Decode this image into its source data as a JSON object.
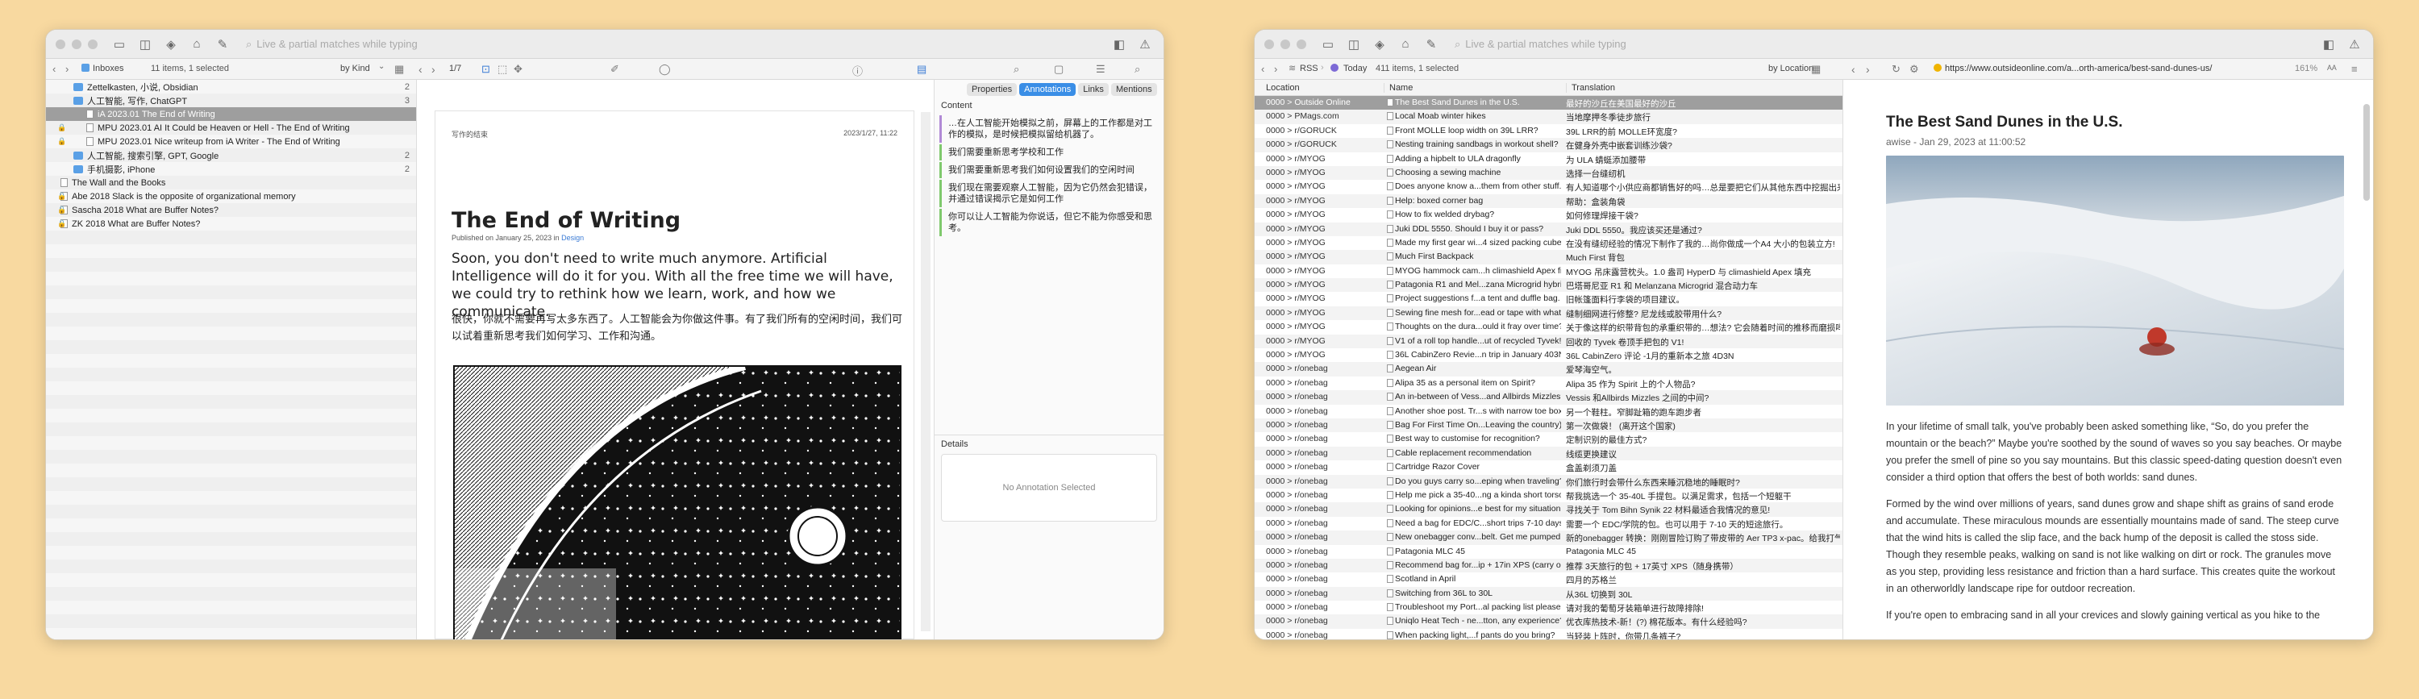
{
  "w1": {
    "search": "Live & partial matches while typing",
    "crumb": "Inboxes",
    "count": "11 items, 1 selected",
    "sort": "by Kind",
    "pager": "1/7",
    "sidebar": [
      {
        "label": "Zettelkasten, 小说, Obsidian",
        "kind": "folder",
        "indent": 1,
        "count": "2"
      },
      {
        "label": "人工智能, 写作, ChatGPT",
        "kind": "folder",
        "indent": 1,
        "count": "3"
      },
      {
        "label": "iA 2023.01 The End of Writing",
        "kind": "doc",
        "indent": 2,
        "count": "",
        "selected": true
      },
      {
        "label": "MPU 2023.01 AI It Could be Heaven or Hell - The End of Writing",
        "kind": "doc",
        "indent": 2,
        "count": "",
        "lock": true
      },
      {
        "label": "MPU 2023.01 Nice writeup from iA Writer - The End of Writing",
        "kind": "doc",
        "indent": 2,
        "count": "",
        "lock": true
      },
      {
        "label": "人工智能, 搜索引擎, GPT, Google",
        "kind": "folder",
        "indent": 1,
        "count": "2"
      },
      {
        "label": "手机摄影, iPhone",
        "kind": "folder",
        "indent": 1,
        "count": "2"
      },
      {
        "label": "The Wall and the Books",
        "kind": "doc",
        "indent": 0,
        "count": ""
      },
      {
        "label": "Abe 2018 Slack is the opposite of organizational memory",
        "kind": "doc",
        "indent": 0,
        "count": "",
        "lock": true
      },
      {
        "label": "Sascha 2018 What are Buffer Notes?",
        "kind": "doc",
        "indent": 0,
        "count": "",
        "lock": true
      },
      {
        "label": "ZK 2018 What are Buffer Notes?",
        "kind": "doc",
        "indent": 0,
        "count": "",
        "lock": true
      }
    ],
    "doc": {
      "meta_left": "写作的结束",
      "meta_right": "2023/1/27, 11:22",
      "title": "The End of Writing",
      "byline": "Published on January 25, 2023 in",
      "byline_link": "Design",
      "lead": "Soon, you don't need to write much anymore. Artificial Intelligence will do it for you. With all the free time we will have, we could try to rethink how we learn, work, and how we communicate.",
      "cn": "很快，你就不需要再写太多东西了。人工智能会为你做这件事。有了我们所有的空闲时间，我们可以试着重新思考我们如何学习、工作和沟通。"
    },
    "tabs": [
      "Properties",
      "Annotations",
      "Links",
      "Mentions"
    ],
    "content_label": "Content",
    "highlights": [
      {
        "text": "…在人工智能开始模拟之前，屏幕上的工作都是对工作的模拟，是时候把模拟留给机器了。",
        "color": "#b18ad6"
      },
      {
        "text": "我们需要重新思考学校和工作",
        "color": "#7fc96d"
      },
      {
        "text": "我们需要重新思考我们如何设置我们的空闲时间",
        "color": "#7fc96d"
      },
      {
        "text": "我们现在需要观察人工智能，因为它仍然会犯错误，并通过错误揭示它是如何工作",
        "color": "#7fc96d"
      },
      {
        "text": "你可以让人工智能为你说话，但它不能为你感受和思考。",
        "color": "#7fc96d"
      }
    ],
    "details_label": "Details",
    "no_annotation": "No Annotation Selected"
  },
  "w2": {
    "search": "Live & partial matches while typing",
    "crumb_rss": "RSS",
    "crumb_today": "Today",
    "count": "411 items, 1 selected",
    "sort": "by Location",
    "cols": [
      "Location",
      "Name",
      "Translation"
    ],
    "url": "https://www.outsideonline.com/a...orth-america/best-sand-dunes-us/",
    "zoom": "161%",
    "rows": [
      [
        "0000 > Outside Online",
        "The Best Sand Dunes in the U.S.",
        "最好的沙丘在美国最好的沙丘"
      ],
      [
        "0000 > PMags.com",
        "Local Moab winter hikes",
        "当地摩押冬季徒步旅行"
      ],
      [
        "0000 > r/GORUCK",
        "Front MOLLE loop width on 39L LRR?",
        "39L LRR的前 MOLLE环宽度?"
      ],
      [
        "0000 > r/GORUCK",
        "Nesting training sandbags in workout shell?",
        "在健身外壳中嵌套训练沙袋?"
      ],
      [
        "0000 > r/MYOG",
        "Adding a hipbelt to ULA dragonfly",
        "为 ULA 蜻蜓添加腰带"
      ],
      [
        "0000 > r/MYOG",
        "Choosing a sewing machine",
        "选择一台缝纫机"
      ],
      [
        "0000 > r/MYOG",
        "Does anyone know a...them from other stuff.",
        "有人知道哪个小供应商都销售好的吗…总是要把它们从其他东西中挖掘出来。"
      ],
      [
        "0000 > r/MYOG",
        "Help: boxed corner bag",
        "帮助：盒装角袋"
      ],
      [
        "0000 > r/MYOG",
        "How to fix welded drybag?",
        "如何修理焊接干袋?"
      ],
      [
        "0000 > r/MYOG",
        "Juki DDL 5550. Should I buy it or pass?",
        "Juki DDL 5550。我应该买还是通过?"
      ],
      [
        "0000 > r/MYOG",
        "Made my first gear wi...4 sized packing cube!",
        "在没有缝纫经验的情况下制作了我的…尚你做成一个A4 大小的包装立方!"
      ],
      [
        "0000 > r/MYOG",
        "Much First Backpack",
        "Much First 背包"
      ],
      [
        "0000 > r/MYOG",
        "MYOG hammock cam...h climashield Apex fill",
        "MYOG 吊床露营枕头。1.0 盎司 HyperD 与 climashield Apex 填充"
      ],
      [
        "0000 > r/MYOG",
        "Patagonia R1 and Mel...zana Microgrid hybrid",
        "巴塔哥尼亚 R1 和 Melanzana Microgrid 混合动力车"
      ],
      [
        "0000 > r/MYOG",
        "Project suggestions f...a tent and duffle bag.",
        "旧帐篷面料行李袋的项目建议。"
      ],
      [
        "0000 > r/MYOG",
        "Sewing fine mesh for...ead or tape with what?",
        "缝制细网进行修整? 尼龙线或胶带用什么?"
      ],
      [
        "0000 > r/MYOG",
        "Thoughts on the dura...ould it fray over time?",
        "关于像这样的织带背包的承重织带的…想法? 它会随着时间的推移而磨损吗?"
      ],
      [
        "0000 > r/MYOG",
        "V1 of a roll top handle...ut of recycled Tyvek!",
        "回收的 Tyvek 卷顶手把包的 V1!"
      ],
      [
        "0000 > r/MYOG",
        "36L CabinZero Revie...n trip in January 403N",
        "36L CabinZero 评论 -1月的重新本之旅 4D3N"
      ],
      [
        "0000 > r/onebag",
        "Aegean Air",
        "爱琴海空气。"
      ],
      [
        "0000 > r/onebag",
        "Alipa 35 as a personal item on Spirit?",
        "Alipa 35 作为 Spirit 上的个人物品?"
      ],
      [
        "0000 > r/onebag",
        "An in-between of Vess...and Allbirds Mizzles?",
        "Vessis 和Allbirds Mizzles 之间的中间?"
      ],
      [
        "0000 > r/onebag",
        "Another shoe post. Tr...s with narrow toe box",
        "另一个鞋柱。窄脚趾箱的跑车跑步者"
      ],
      [
        "0000 > r/onebag",
        "Bag For First Time On...Leaving the country)",
        "第一次做袋！ (离开这个国家)"
      ],
      [
        "0000 > r/onebag",
        "Best way to customise for recognition?",
        "定制识别的最佳方式?"
      ],
      [
        "0000 > r/onebag",
        "Cable replacement recommendation",
        "线缆更换建议"
      ],
      [
        "0000 > r/onebag",
        "Cartridge Razor Cover",
        "盒盖剃须刀盖"
      ],
      [
        "0000 > r/onebag",
        "Do you guys carry so...eping when traveling?",
        "你们旅行时会带什么东西来睡沉稳地的睡眠时?"
      ],
      [
        "0000 > r/onebag",
        "Help me pick a 35-40...ng a kinda short torso",
        "帮我挑选一个 35-40L 手提包。以满足需求，包括一个短躯干"
      ],
      [
        "0000 > r/onebag",
        "Looking for opinions...e best for my situation",
        "寻找关于 Tom Bihn Synik 22 材料最适合我情况的意见!"
      ],
      [
        "0000 > r/onebag",
        "Need a bag for EDC/C...short trips 7-10 days.",
        "需要一个 EDC/学院的包。也可以用于 7-10 天的短途旅行。"
      ],
      [
        "0000 > r/onebag",
        "New onebagger conv...belt. Get me pumped.",
        "新的onebagger 转换：刚刚冒险订购了带皮带的 Aer TP3 x-pac。给我打气。"
      ],
      [
        "0000 > r/onebag",
        "Patagonia MLC 45",
        "Patagonia MLC 45"
      ],
      [
        "0000 > r/onebag",
        "Recommend bag for...ip + 17in XPS (carry on)",
        "推荐 3天旅行的包 + 17英寸 XPS（随身携带）"
      ],
      [
        "0000 > r/onebag",
        "Scotland in April",
        "四月的苏格兰"
      ],
      [
        "0000 > r/onebag",
        "Switching from 36L to 30L",
        "从36L 切换到 30L"
      ],
      [
        "0000 > r/onebag",
        "Troubleshoot my Port...al packing list please!",
        "请对我的葡萄牙装箱单进行故障排除!"
      ],
      [
        "0000 > r/onebag",
        "Uniqlo Heat Tech - ne...tton, any experience?",
        "优衣库热技术-新！(?) 棉花版本。有什么经验吗?"
      ],
      [
        "0000 > r/onebag",
        "When packing light,...f pants do you bring?",
        "当轻装上阵时，你带几条裤子?"
      ]
    ],
    "article": {
      "title": "The Best Sand Dunes in the U.S.",
      "byline": "awise - Jan 29, 2023 at 11:00:52",
      "p1": "In your lifetime of small talk, you've probably been asked something like, “So, do you prefer the mountain or the beach?” Maybe you're soothed by the sound of waves so you say beaches. Or maybe you prefer the smell of pine so you say mountains. But this classic speed-dating question doesn't even consider a third option that offers the best of both worlds: sand dunes.",
      "p2": "Formed by the wind over millions of years, sand dunes grow and shape shift as grains of sand erode and accumulate. These miraculous mounds are essentially mountains made of sand. The steep curve that the wind hits is called the slip face, and the back hump of the deposit is called the stoss side. Though they resemble peaks, walking on sand is not like walking on dirt or rock. The granules move as you step, providing less resistance and friction than a hard surface. This creates quite the workout in an otherworldly landscape ripe for outdoor recreation.",
      "p3": "If you're open to embracing sand in all your crevices and slowly gaining vertical as you hike to the"
    }
  }
}
